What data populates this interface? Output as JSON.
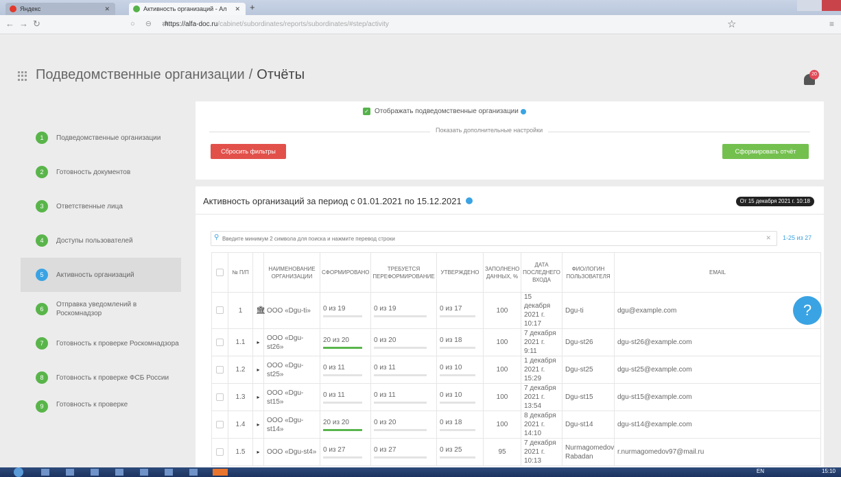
{
  "browser": {
    "tabs": [
      {
        "label": "Яндекс",
        "favicon_color": "#e3382b"
      },
      {
        "label": "Активность организаций - Ал",
        "favicon_color": "#55b24a"
      }
    ],
    "url_host": "https://alfa-doc.ru",
    "url_path": "/cabinet/subordinates/reports/subordinates/#step/activity"
  },
  "header": {
    "section": "Подведомственные организации",
    "separator": "/",
    "page": "Отчёты",
    "notifications_count": "20"
  },
  "sidebar": {
    "items": [
      {
        "num": "1",
        "label": "Подведомственные организации",
        "active": false
      },
      {
        "num": "2",
        "label": "Готовность документов",
        "active": false
      },
      {
        "num": "3",
        "label": "Ответственные лица",
        "active": false
      },
      {
        "num": "4",
        "label": "Доступы пользователей",
        "active": false
      },
      {
        "num": "5",
        "label": "Активность организаций",
        "active": true
      },
      {
        "num": "6",
        "label": "Отправка уведомлений в Роскомнадзор",
        "active": false
      },
      {
        "num": "7",
        "label": "Готовность к проверке Роскомнадзора",
        "active": false
      },
      {
        "num": "8",
        "label": "Готовность к проверке ФСБ России",
        "active": false
      },
      {
        "num": "9",
        "label": "Готовность к проверке",
        "active": false
      }
    ]
  },
  "filters": {
    "show_subordinates_label": "Отображать подведомственные организации",
    "more_settings": "Показать дополнительные настройки",
    "reset_button": "Сбросить фильтры",
    "generate_button": "Сформировать отчёт"
  },
  "report": {
    "title": "Активность организаций за период с 01.01.2021 по 15.12.2021",
    "date_badge": "От 15 декабря 2021 г. 10:18",
    "search_placeholder": "Введите минимум 2 символа для поиска и нажмите перевод строки",
    "counter": "1-25 из 27",
    "columns": [
      "№ П/П",
      "НАИМЕНОВАНИЕ ОРГАНИЗАЦИИ",
      "СФОРМИРОВАНО",
      "ТРЕБУЕТСЯ ПЕРЕФОРМИРОВАНИЕ",
      "УТВЕРЖДЕНО",
      "ЗАПОЛНЕНО ДАННЫХ, %",
      "ДАТА ПОСЛЕДНЕГО ВХОДА",
      "ФИО/ЛОГИН ПОЛЬЗОВАТЕЛЯ",
      "EMAIL"
    ],
    "rows": [
      {
        "num": "1",
        "marker": "bank",
        "org": "ООО «Dgu-ti»",
        "formed": "0 из 19",
        "formed_pct": 0,
        "reform": "0 из 19",
        "approved": "0 из 17",
        "filled": "100",
        "last_login": "15 декабря 2021 г. 10:17",
        "user": "Dgu-ti",
        "email": "dgu@example.com"
      },
      {
        "num": "1.1",
        "marker": "arrow",
        "org": "ООО «Dgu-st26»",
        "formed": "20 из 20",
        "formed_pct": 100,
        "reform": "0 из 20",
        "approved": "0 из 18",
        "filled": "100",
        "last_login": "7 декабря 2021 г. 9:11",
        "user": "Dgu-st26",
        "email": "dgu-st26@example.com"
      },
      {
        "num": "1.2",
        "marker": "arrow",
        "org": "ООО «Dgu-st25»",
        "formed": "0 из 11",
        "formed_pct": 0,
        "reform": "0 из 11",
        "approved": "0 из 10",
        "filled": "100",
        "last_login": "1 декабря 2021 г. 15:29",
        "user": "Dgu-st25",
        "email": "dgu-st25@example.com"
      },
      {
        "num": "1.3",
        "marker": "arrow",
        "org": "ООО «Dgu-st15»",
        "formed": "0 из 11",
        "formed_pct": 0,
        "reform": "0 из 11",
        "approved": "0 из 10",
        "filled": "100",
        "last_login": "7 декабря 2021 г. 13:54",
        "user": "Dgu-st15",
        "email": "dgu-st15@example.com"
      },
      {
        "num": "1.4",
        "marker": "arrow",
        "org": "ООО «Dgu-st14»",
        "formed": "20 из 20",
        "formed_pct": 100,
        "reform": "0 из 20",
        "approved": "0 из 18",
        "filled": "100",
        "last_login": "8 декабря 2021 г. 14:10",
        "user": "Dgu-st14",
        "email": "dgu-st14@example.com"
      },
      {
        "num": "1.5",
        "marker": "arrow",
        "org": "ООО «Dgu-st4»",
        "formed": "0 из 27",
        "formed_pct": 0,
        "reform": "0 из 27",
        "approved": "0 из 25",
        "filled": "95",
        "last_login": "7 декабря 2021 г. 10:13",
        "user": "Nurmagomedov Rabadan",
        "email": "r.nurmagomedov97@mail.ru"
      }
    ]
  },
  "help_label": "?",
  "taskbar": {
    "lang": "EN",
    "clock": "15:10"
  },
  "colors": {
    "accent": "#3aa3e3",
    "success": "#59b54a",
    "danger": "#e2504a"
  }
}
